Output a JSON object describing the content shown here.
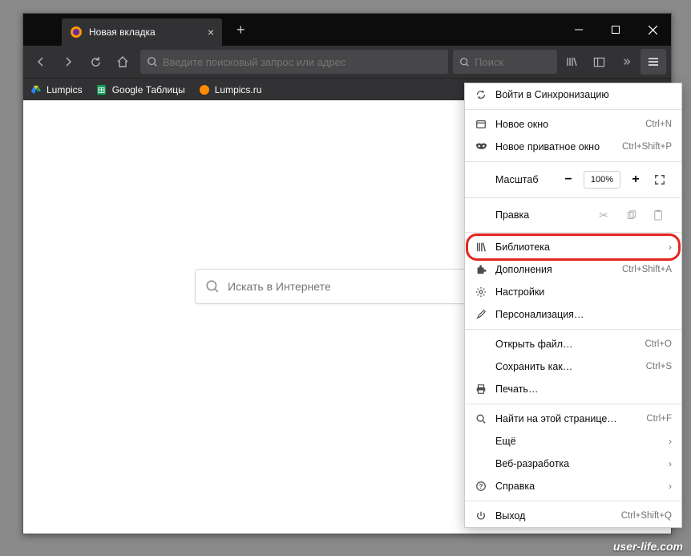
{
  "tab": {
    "title": "Новая вкладка"
  },
  "urlbar": {
    "placeholder": "Введите поисковый запрос или адрес"
  },
  "searchbar": {
    "placeholder": "Поиск"
  },
  "bookmarks": [
    {
      "label": "Lumpics"
    },
    {
      "label": "Google Таблицы"
    },
    {
      "label": "Lumpics.ru"
    }
  ],
  "content": {
    "search_placeholder": "Искать в Интернете"
  },
  "menu": {
    "sync": "Войти в Синхронизацию",
    "new_window": "Новое окно",
    "new_window_sc": "Ctrl+N",
    "new_private": "Новое приватное окно",
    "new_private_sc": "Ctrl+Shift+P",
    "zoom_label": "Масштаб",
    "zoom_value": "100%",
    "edit_label": "Правка",
    "library": "Библиотека",
    "addons": "Дополнения",
    "addons_sc": "Ctrl+Shift+A",
    "settings": "Настройки",
    "customize": "Персонализация…",
    "open_file": "Открыть файл…",
    "open_file_sc": "Ctrl+O",
    "save_as": "Сохранить как…",
    "save_as_sc": "Ctrl+S",
    "print": "Печать…",
    "find": "Найти на этой странице…",
    "find_sc": "Ctrl+F",
    "more": "Ещё",
    "webdev": "Веб-разработка",
    "help": "Справка",
    "quit": "Выход",
    "quit_sc": "Ctrl+Shift+Q"
  },
  "watermark": "user-life.com"
}
